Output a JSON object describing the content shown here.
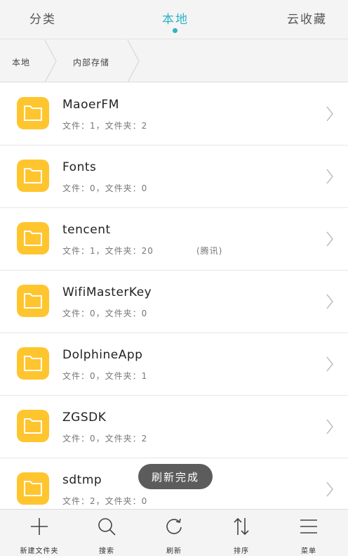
{
  "tabs": [
    {
      "label": "分类"
    },
    {
      "label": "本地"
    },
    {
      "label": "云收藏"
    }
  ],
  "breadcrumb": [
    {
      "label": "本地"
    },
    {
      "label": "内部存储"
    }
  ],
  "files": [
    {
      "name": "MaoerFM",
      "info": "文件：1，文件夹：2",
      "tag": ""
    },
    {
      "name": "Fonts",
      "info": "文件：0，文件夹：0",
      "tag": ""
    },
    {
      "name": "tencent",
      "info": "文件：1，文件夹：20",
      "tag": "(腾讯)"
    },
    {
      "name": "WifiMasterKey",
      "info": "文件：0，文件夹：0",
      "tag": ""
    },
    {
      "name": "DolphineApp",
      "info": "文件：0，文件夹：1",
      "tag": ""
    },
    {
      "name": "ZGSDK",
      "info": "文件：0，文件夹：2",
      "tag": ""
    },
    {
      "name": "sdtmp",
      "info": "文件：2，文件夹：0",
      "tag": ""
    }
  ],
  "toast": "刷新完成",
  "toolbar": [
    {
      "label": "新建文件夹",
      "icon": "plus-icon"
    },
    {
      "label": "搜索",
      "icon": "search-icon"
    },
    {
      "label": "刷新",
      "icon": "refresh-icon"
    },
    {
      "label": "排序",
      "icon": "sort-icon"
    },
    {
      "label": "菜单",
      "icon": "menu-icon"
    }
  ],
  "colors": {
    "accent": "#2fb3c6",
    "folder": "#ffc52f"
  }
}
